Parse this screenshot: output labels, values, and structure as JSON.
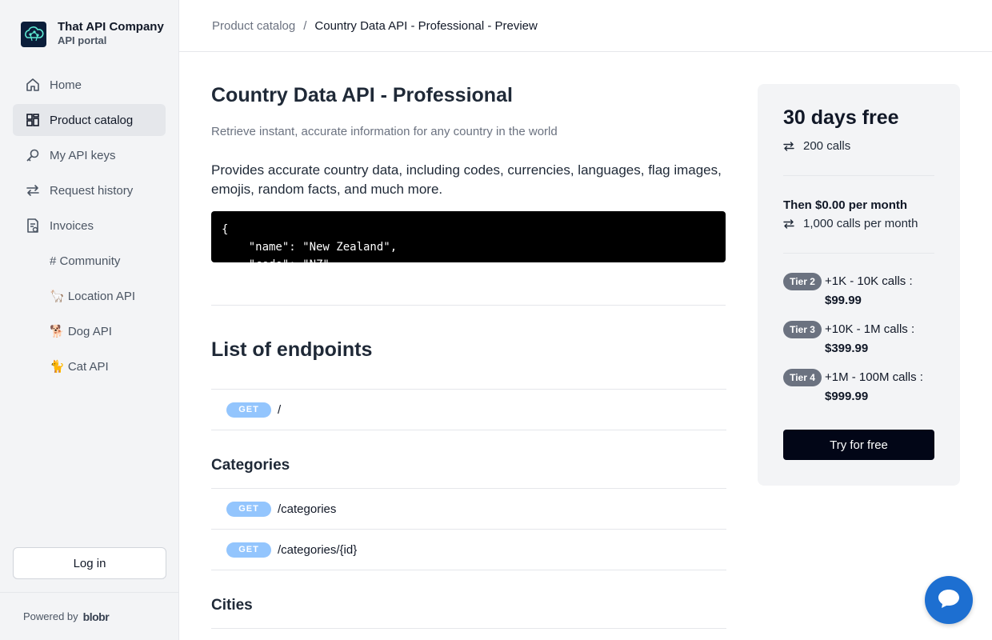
{
  "brand": {
    "name": "That API Company",
    "subtitle": "API portal"
  },
  "sidebar": {
    "items": [
      {
        "label": "Home",
        "icon": "home-icon"
      },
      {
        "label": "Product catalog",
        "icon": "catalog-icon",
        "active": true
      },
      {
        "label": "My API keys",
        "icon": "key-icon"
      },
      {
        "label": "Request history",
        "icon": "arrows-icon"
      },
      {
        "label": "Invoices",
        "icon": "invoice-icon"
      }
    ],
    "links": [
      {
        "label": "# Community"
      },
      {
        "label": "🦙 Location API"
      },
      {
        "label": "🐕 Dog API"
      },
      {
        "label": "🐈 Cat API"
      }
    ],
    "login_label": "Log in",
    "powered_by": "Powered by",
    "powered_logo": "blobr"
  },
  "breadcrumb": {
    "parent": "Product catalog",
    "separator": "/",
    "current": "Country Data API - Professional - Preview"
  },
  "main": {
    "title": "Country Data API - Professional",
    "subtitle": "Retrieve instant, accurate information for any country in the world",
    "description": "Provides accurate country data, including codes, currencies, languages, flag images, emojis, random facts, and much more.",
    "code_sample": "{\n    \"name\": \"New Zealand\",\n    \"code\": \"NZ\",",
    "endpoints_title": "List of endpoints",
    "root_endpoints": [
      {
        "method": "GET",
        "path": "/"
      }
    ],
    "groups": [
      {
        "name": "Categories",
        "endpoints": [
          {
            "method": "GET",
            "path": "/categories"
          },
          {
            "method": "GET",
            "path": "/categories/{id}"
          }
        ]
      },
      {
        "name": "Cities",
        "endpoints": []
      }
    ]
  },
  "pricing": {
    "trial_title": "30 days free",
    "trial_calls": "200 calls",
    "then_label": "Then $0.00 per month",
    "monthly_calls": "1,000 calls per month",
    "tiers": [
      {
        "badge": "Tier 2",
        "range": "+1K - 10K calls :",
        "price": "$99.99"
      },
      {
        "badge": "Tier 3",
        "range": "+10K - 1M calls :",
        "price": "$399.99"
      },
      {
        "badge": "Tier 4",
        "range": "+1M - 100M calls :",
        "price": "$999.99"
      }
    ],
    "cta_label": "Try for free"
  },
  "colors": {
    "sidebar_bg": "#f3f4f6",
    "code_bg": "#000000",
    "method_badge": "#93c5fd",
    "tier_badge": "#6b7280",
    "cta_bg": "#020617",
    "chat_bubble": "#1d6fd1"
  }
}
